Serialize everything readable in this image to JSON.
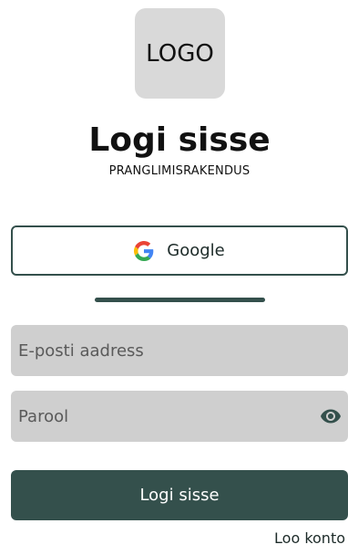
{
  "logo": {
    "text": "LOGO"
  },
  "header": {
    "title": "Logi sisse",
    "subtitle": "PRANGLIMISRAKENDUS"
  },
  "google_button": {
    "label": "Google",
    "icon": "google-g-icon"
  },
  "form": {
    "email": {
      "placeholder": "E-posti aadress",
      "value": ""
    },
    "password": {
      "placeholder": "Parool",
      "value": "",
      "icon": "eye-icon"
    },
    "submit_label": "Logi sisse"
  },
  "create_account": {
    "label": "Loo konto"
  },
  "colors": {
    "accent": "#34504c",
    "field_bg": "#cfcfcf",
    "logo_bg": "#d9d9d9"
  }
}
